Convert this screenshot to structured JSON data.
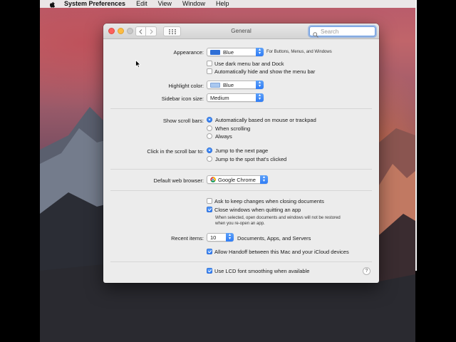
{
  "menubar": {
    "app_name": "System Preferences",
    "items": [
      "Edit",
      "View",
      "Window",
      "Help"
    ]
  },
  "window": {
    "title": "General",
    "search_placeholder": "Search"
  },
  "appearance": {
    "label": "Appearance:",
    "value": "Blue",
    "swatch_color": "#2f6fd6",
    "note": "For Buttons, Menus, and Windows",
    "dark_menu_bar": {
      "label": "Use dark menu bar and Dock",
      "checked": false
    },
    "auto_hide_menu": {
      "label": "Automatically hide and show the menu bar",
      "checked": false
    }
  },
  "highlight": {
    "label": "Highlight color:",
    "value": "Blue",
    "swatch_color": "#a9c8f0"
  },
  "sidebar_icon": {
    "label": "Sidebar icon size:",
    "value": "Medium"
  },
  "scroll_bars": {
    "label": "Show scroll bars:",
    "options": [
      "Automatically based on mouse or trackpad",
      "When scrolling",
      "Always"
    ],
    "selected": 0
  },
  "click_scroll": {
    "label": "Click in the scroll bar to:",
    "options": [
      "Jump to the next page",
      "Jump to the spot that's clicked"
    ],
    "selected": 0
  },
  "browser": {
    "label": "Default web browser:",
    "value": "Google Chrome"
  },
  "documents": {
    "ask_keep_changes": {
      "label": "Ask to keep changes when closing documents",
      "checked": false
    },
    "close_windows": {
      "label": "Close windows when quitting an app",
      "checked": true
    },
    "close_windows_note_1": "When selected, open documents and windows will not be restored",
    "close_windows_note_2": "when you re-open an app."
  },
  "recent_items": {
    "label": "Recent items:",
    "value": "10",
    "suffix": "Documents, Apps, and Servers"
  },
  "handoff": {
    "label": "Allow Handoff between this Mac and your iCloud devices",
    "checked": true
  },
  "lcd_font": {
    "label": "Use LCD font smoothing when available",
    "checked": true
  },
  "help": "?"
}
